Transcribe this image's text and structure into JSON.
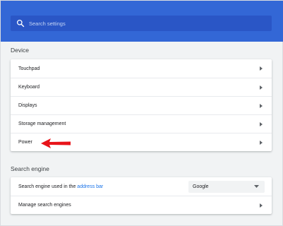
{
  "search": {
    "placeholder": "Search settings"
  },
  "device": {
    "title": "Device",
    "items": [
      {
        "label": "Touchpad"
      },
      {
        "label": "Keyboard"
      },
      {
        "label": "Displays"
      },
      {
        "label": "Storage management"
      },
      {
        "label": "Power"
      }
    ]
  },
  "search_engine": {
    "title": "Search engine",
    "used_label_prefix": "Search engine used in the",
    "used_label_link": "address bar",
    "selected": "Google",
    "manage_label": "Manage search engines"
  },
  "colors": {
    "header": "#3367d6",
    "search_box": "#2a56c6",
    "background": "#f1f3f4",
    "link": "#1a73e8",
    "annotation_arrow": "#e8141a"
  },
  "icons": {
    "search": "search-icon",
    "row_arrow": "chevron-right-icon",
    "dropdown": "caret-down-icon",
    "annotation": "red-arrow-icon"
  }
}
